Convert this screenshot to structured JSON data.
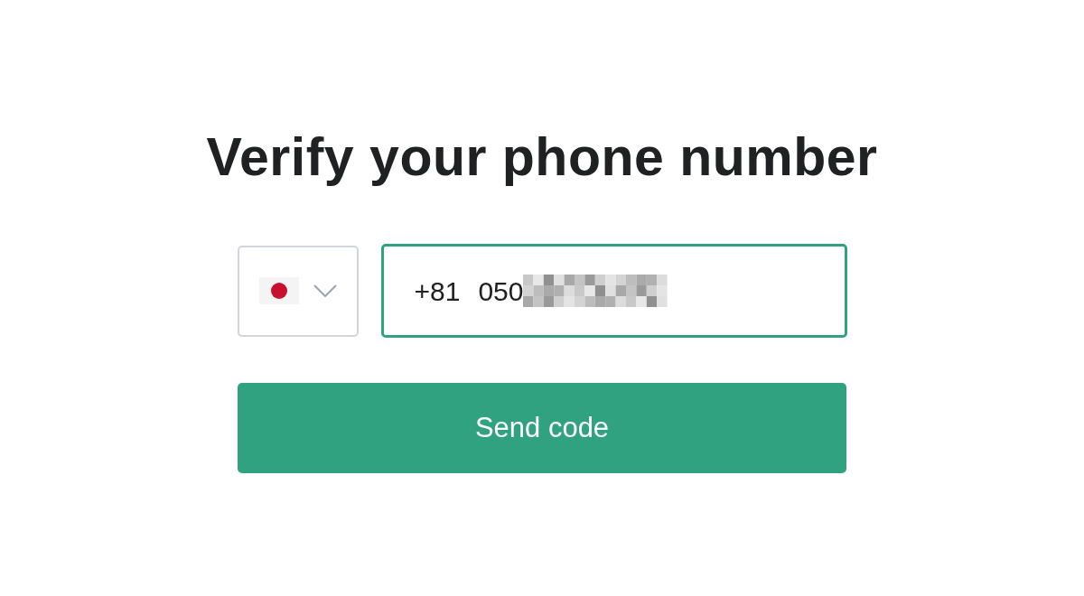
{
  "title": "Verify your phone number",
  "country_select": {
    "expanded": false
  },
  "phone_field": {
    "country_code": "+81",
    "value": "050",
    "focused": true,
    "redacted": true
  },
  "submit_button": {
    "label": "Send code"
  }
}
